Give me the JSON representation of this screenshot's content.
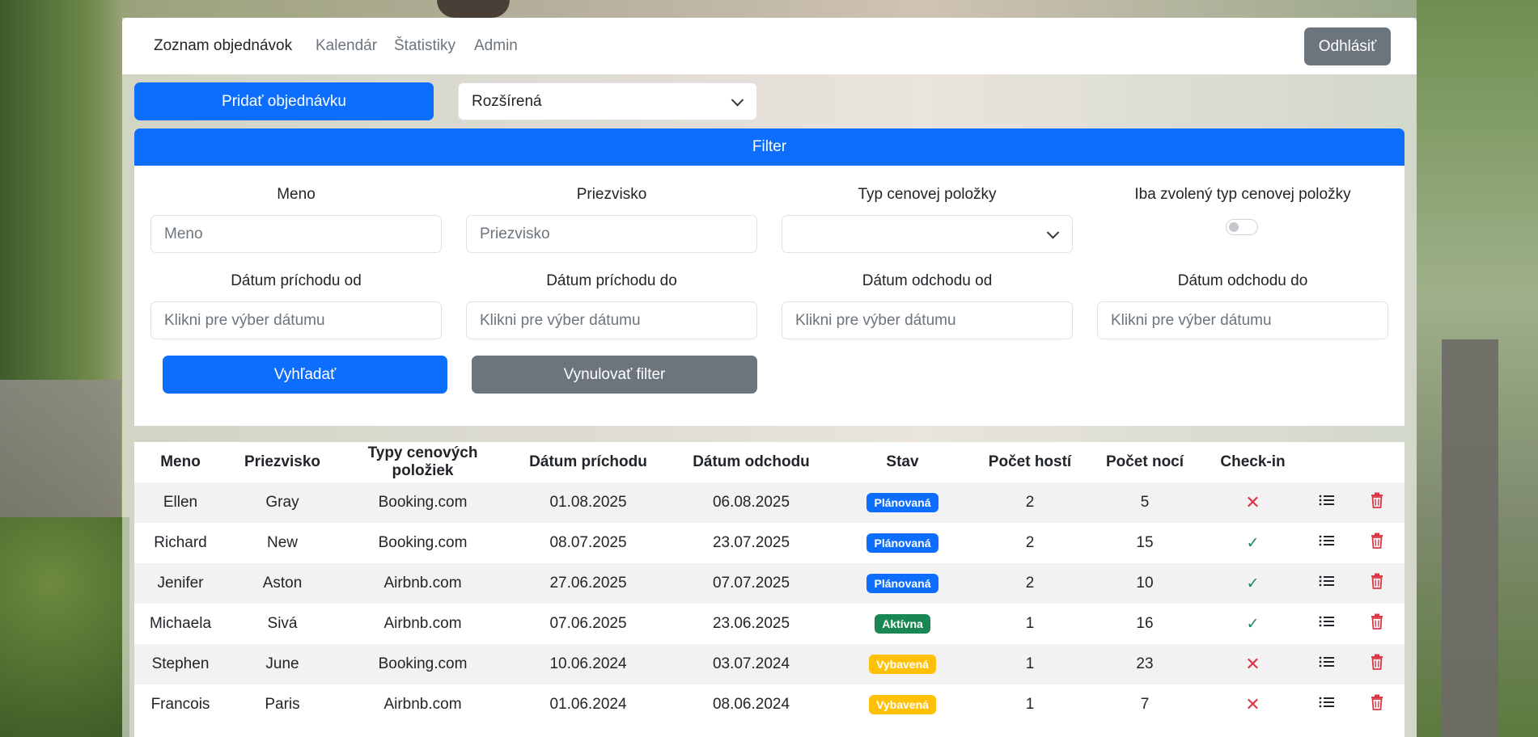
{
  "nav": {
    "links": [
      "Zoznam objednávok",
      "Kalendár",
      "Štatistiky",
      "Admin"
    ],
    "logout": "Odhlásiť"
  },
  "toolbar": {
    "add_order": "Pridať objednávku",
    "view_select": "Rozšírená"
  },
  "filter": {
    "title": "Filter",
    "first_name_label": "Meno",
    "first_name_placeholder": "Meno",
    "last_name_label": "Priezvisko",
    "last_name_placeholder": "Priezvisko",
    "price_type_label": "Typ cenovej položky",
    "price_type_value": "",
    "only_selected_label": "Iba zvolený typ cenovej položky",
    "only_selected_on": false,
    "arrival_from_label": "Dátum príchodu od",
    "arrival_to_label": "Dátum príchodu do",
    "departure_from_label": "Dátum odchodu od",
    "departure_to_label": "Dátum odchodu do",
    "date_placeholder": "Klikni pre výber dátumu",
    "search_button": "Vyhľadať",
    "reset_button": "Vynulovať filter"
  },
  "table": {
    "headers": [
      "Meno",
      "Priezvisko",
      "Typy cenových položiek",
      "Dátum príchodu",
      "Dátum odchodu",
      "Stav",
      "Počet hostí",
      "Počet nocí",
      "Check-in"
    ],
    "rows": [
      {
        "first": "Ellen",
        "last": "Gray",
        "type": "Booking.com",
        "arrival": "01.08.2025",
        "departure": "06.08.2025",
        "status": "Plánovaná",
        "status_color": "#0d6efd",
        "guests": "2",
        "nights": "5",
        "checkin": false
      },
      {
        "first": "Richard",
        "last": "New",
        "type": "Booking.com",
        "arrival": "08.07.2025",
        "departure": "23.07.2025",
        "status": "Plánovaná",
        "status_color": "#0d6efd",
        "guests": "2",
        "nights": "15",
        "checkin": true
      },
      {
        "first": "Jenifer",
        "last": "Aston",
        "type": "Airbnb.com",
        "arrival": "27.06.2025",
        "departure": "07.07.2025",
        "status": "Plánovaná",
        "status_color": "#0d6efd",
        "guests": "2",
        "nights": "10",
        "checkin": true
      },
      {
        "first": "Michaela",
        "last": "Sivá",
        "type": "Airbnb.com",
        "arrival": "07.06.2025",
        "departure": "23.06.2025",
        "status": "Aktívna",
        "status_color": "#198754",
        "guests": "1",
        "nights": "16",
        "checkin": true
      },
      {
        "first": "Stephen",
        "last": "June",
        "type": "Booking.com",
        "arrival": "10.06.2024",
        "departure": "03.07.2024",
        "status": "Vybavená",
        "status_color": "#ffc107",
        "guests": "1",
        "nights": "23",
        "checkin": false
      },
      {
        "first": "Francois",
        "last": "Paris",
        "type": "Airbnb.com",
        "arrival": "01.06.2024",
        "departure": "08.06.2024",
        "status": "Vybavená",
        "status_color": "#ffc107",
        "guests": "1",
        "nights": "7",
        "checkin": false
      }
    ]
  },
  "colors": {
    "primary": "#0d6efd",
    "secondary": "#6c757d",
    "success": "#198754",
    "warning": "#ffc107",
    "danger": "#dc3545"
  }
}
